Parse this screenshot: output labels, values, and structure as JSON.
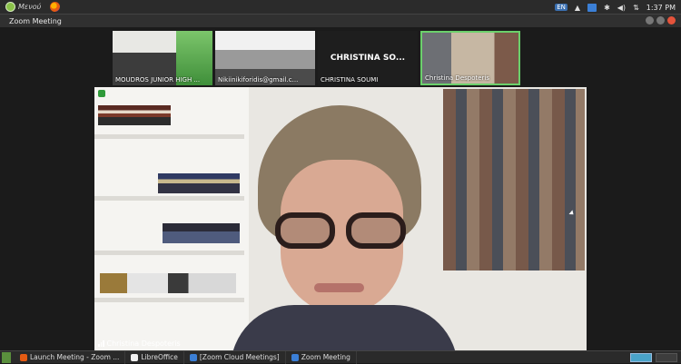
{
  "topbar": {
    "menu_label": "Μενού",
    "lang": "EN",
    "clock": "1:37 PM"
  },
  "window": {
    "title": "Zoom Meeting"
  },
  "participants": [
    {
      "name": "MOUDROS JUNIOR HIGH ..."
    },
    {
      "name": "Nikiinikiforidis@gmail.c..."
    },
    {
      "name": "CHRISTINA SOUMI",
      "big_label": "CHRISTINA SO..."
    },
    {
      "name": "Christina Despoteris"
    }
  ],
  "main_video": {
    "speaker_name": "Christina Despoteris"
  },
  "taskbar": {
    "items": [
      {
        "label": "Launch Meeting - Zoom ..."
      },
      {
        "label": "LibreOffice"
      },
      {
        "label": "[Zoom Cloud Meetings]"
      },
      {
        "label": "Zoom Meeting"
      }
    ]
  },
  "colors": {
    "active_speaker_border": "#6bd06b",
    "taskbar_bg": "#2a2a2a",
    "close_button": "#e5533b"
  }
}
